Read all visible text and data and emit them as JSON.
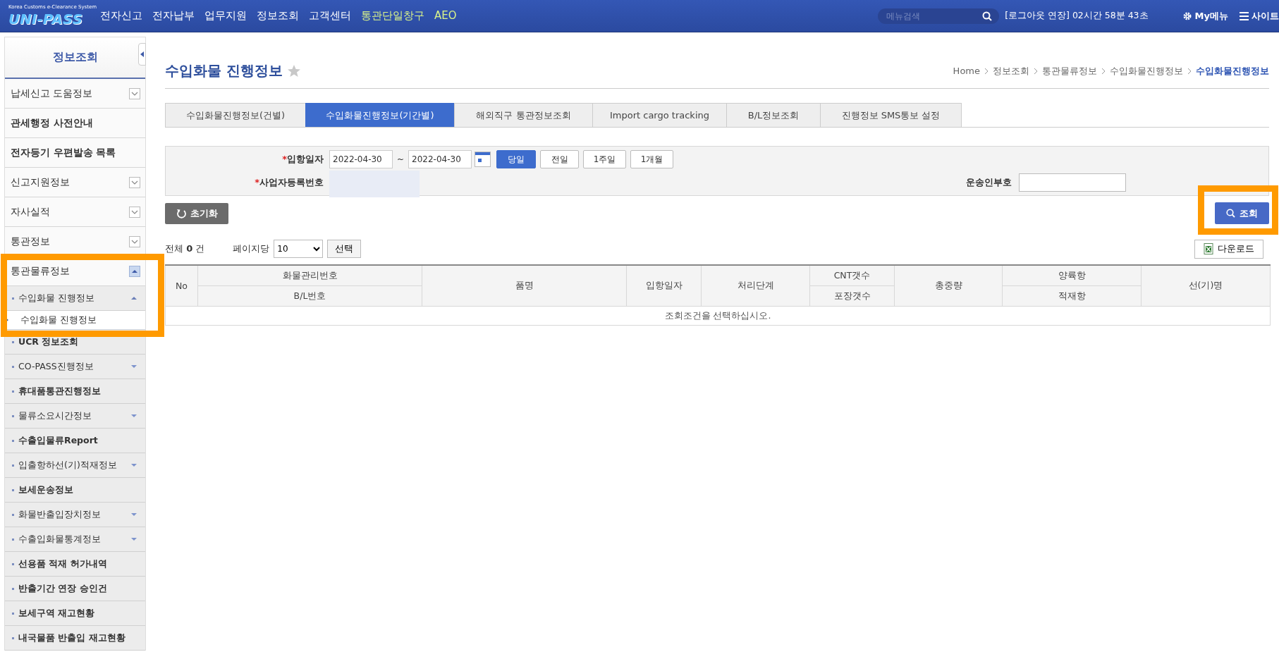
{
  "topbar": {
    "logo": {
      "tagline": "Korea Customs e-Clearance System",
      "name": "UNI-PASS"
    },
    "nav": [
      {
        "label": "전자신고",
        "color": "#ffffff"
      },
      {
        "label": "전자납부",
        "color": "#ffffff"
      },
      {
        "label": "업무지원",
        "color": "#ffffff"
      },
      {
        "label": "정보조회",
        "color": "#ffffff"
      },
      {
        "label": "고객센터",
        "color": "#ffffff"
      },
      {
        "label": "통관단일창구",
        "color": "#d8f28a"
      },
      {
        "label": "AEO",
        "color": "#d8f28a"
      }
    ],
    "search": {
      "placeholder": "메뉴검색"
    },
    "session": "[로그아웃 연장] 02시간 58분 43초",
    "my_menu": "My메뉴",
    "site": "사이트"
  },
  "sidebar": {
    "title": "정보조회",
    "items": [
      {
        "label": "납세신고 도움정보",
        "kind": "menu",
        "expanded": false
      },
      {
        "label": "관세행정 사전안내",
        "kind": "link"
      },
      {
        "label": "전자등기 우편발송 목록",
        "kind": "link"
      },
      {
        "label": "신고지원정보",
        "kind": "menu",
        "expanded": false
      },
      {
        "label": "자사실적",
        "kind": "menu",
        "expanded": false
      },
      {
        "label": "통관정보",
        "kind": "menu",
        "expanded": false
      },
      {
        "label": "통관물류정보",
        "kind": "menu",
        "expanded": true,
        "highlighted": true,
        "children": [
          {
            "label": "수입화물 진행정보",
            "kind": "menu",
            "expanded": true,
            "children": [
              {
                "label": "수입화물 진행정보",
                "selected": true
              }
            ]
          },
          {
            "label": "UCR 정보조회",
            "kind": "link"
          },
          {
            "label": "CO-PASS진행정보",
            "kind": "menu",
            "expanded": false
          },
          {
            "label": "휴대품통관진행정보",
            "kind": "link"
          },
          {
            "label": "물류소요시간정보",
            "kind": "menu",
            "expanded": false
          },
          {
            "label": "수출입물류Report",
            "kind": "link"
          },
          {
            "label": "입출항하선(기)적재정보",
            "kind": "menu",
            "expanded": false
          },
          {
            "label": "보세운송정보",
            "kind": "link"
          },
          {
            "label": "화물반출입장치정보",
            "kind": "menu",
            "expanded": false
          },
          {
            "label": "수출입화물통계정보",
            "kind": "menu",
            "expanded": false
          },
          {
            "label": "선용품 적재 허가내역",
            "kind": "link"
          },
          {
            "label": "반출기간 연장 승인건",
            "kind": "link"
          },
          {
            "label": "보세구역 재고현황",
            "kind": "link"
          },
          {
            "label": "내국물품 반출입 재고현황",
            "kind": "link"
          }
        ]
      }
    ]
  },
  "page": {
    "title": "수입화물 진행정보",
    "favorite": false,
    "breadcrumb": [
      {
        "label": "Home",
        "current": false
      },
      {
        "label": "정보조회",
        "current": false
      },
      {
        "label": "통관물류정보",
        "current": false
      },
      {
        "label": "수입화물진행정보",
        "current": false
      },
      {
        "label": "수입화물진행정보",
        "current": true
      }
    ],
    "tabs": [
      {
        "label": "수입화물진행정보(건별)",
        "selected": false
      },
      {
        "label": "수입화물진행정보(기간별)",
        "selected": true
      },
      {
        "label": "해외직구 통관정보조회",
        "selected": false
      },
      {
        "label": "Import cargo tracking",
        "selected": false
      },
      {
        "label": "B/L정보조회",
        "selected": false
      },
      {
        "label": "진행정보 SMS통보 설정",
        "selected": false
      }
    ]
  },
  "search_form": {
    "date_field": {
      "mark": "*",
      "label": "입항일자",
      "from": "2022-04-30",
      "separator": "~",
      "to": "2022-04-30"
    },
    "periods": [
      {
        "label": "당일",
        "selected": true
      },
      {
        "label": "전일",
        "selected": false
      },
      {
        "label": "1주일",
        "selected": false
      },
      {
        "label": "1개월",
        "selected": false
      }
    ],
    "business_no": {
      "mark": "*",
      "label": "사업자등록번호"
    },
    "carrier": {
      "label": "운송인부호"
    },
    "reset_button": "초기화",
    "search_button": {
      "label": "조회",
      "highlighted": true
    }
  },
  "results": {
    "total": "전체 **0** 건",
    "page_size_label": "페이지당",
    "page_size": "10",
    "apply_button": "선택",
    "download_button": "다운로드",
    "columns": [
      {
        "label": "No"
      },
      {
        "label": "화물관리번호",
        "sub_label": "B/L번호"
      },
      {
        "label": "품명"
      },
      {
        "label": "입항일자"
      },
      {
        "label": "처리단계"
      },
      {
        "label": "CNT갯수",
        "sub_label": "포장갯수"
      },
      {
        "label": "총중량"
      },
      {
        "label": "양륙항",
        "sub_label": "적재항"
      },
      {
        "label": "선(기)명"
      }
    ],
    "empty_message": "조회조건을 선택하십시오."
  }
}
